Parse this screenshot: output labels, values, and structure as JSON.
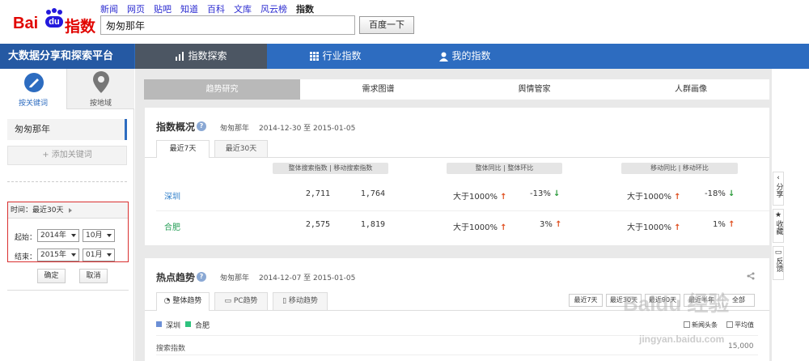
{
  "logo": {
    "bai": "Bai",
    "du": "du",
    "zhishu": "指数"
  },
  "topnav": [
    "新闻",
    "网页",
    "贴吧",
    "知道",
    "百科",
    "文库",
    "风云榜",
    "指数"
  ],
  "search": {
    "value": "匆匆那年",
    "button": "百度一下"
  },
  "nav": {
    "brand": "大数据分享和探索平台",
    "explore": "指数探索",
    "industry": "行业指数",
    "mine": "我的指数"
  },
  "sidebar": {
    "kw_tab": "按关键词",
    "area_tab": "按地域",
    "keyword": "匆匆那年",
    "add_kw": "+ 添加关键词",
    "time_header": "时间：最近30天",
    "start_label": "起始：",
    "end_label": "结束：",
    "start_year": "2014年",
    "start_month": "10月",
    "end_year": "2015年",
    "end_month": "01月",
    "confirm": "确定",
    "cancel": "取消"
  },
  "tabs": [
    "趋势研究",
    "需求图谱",
    "舆情管家",
    "人群画像"
  ],
  "overview": {
    "title": "指数概况",
    "keyword": "匆匆那年",
    "range": "2014-12-30 至 2015-01-05",
    "tab7": "最近7天",
    "tab30": "最近30天",
    "headers": {
      "search": "整体搜索指数",
      "mobile": "移动搜索指数",
      "yoy": "整体同比",
      "mom": "整体环比",
      "myoy": "移动同比",
      "mmom": "移动环比"
    },
    "rows": [
      {
        "city": "深圳",
        "search": "2,711",
        "mobile": "1,764",
        "yoy": "大于1000%",
        "mom": "-13%",
        "myoy": "大于1000%",
        "mmom": "-18%"
      },
      {
        "city": "合肥",
        "search": "2,575",
        "mobile": "1,819",
        "yoy": "大于1000%",
        "mom": "3%",
        "myoy": "大于1000%",
        "mmom": "1%"
      }
    ]
  },
  "trend": {
    "title": "热点趋势",
    "keyword": "匆匆那年",
    "range": "2014-12-07 至 2015-01-05",
    "subtabs": [
      "整体趋势",
      "PC趋势",
      "移动趋势"
    ],
    "ranges": [
      "最近7天",
      "最近30天",
      "最近90天",
      "最近半年",
      "全部"
    ],
    "legend": [
      "深圳",
      "合肥"
    ],
    "opt1": "新闻头条",
    "opt2": "平均值",
    "ylabel": "搜索指数",
    "ymax": "15,000"
  },
  "right_tools": [
    "分享",
    "收藏",
    "反馈"
  ],
  "watermark": {
    "main": "Baidu 经验",
    "url": "jingyan.baidu.com"
  },
  "colors": {
    "brand_blue": "#2d6cc0",
    "up": "#e05020",
    "down": "#2a9a3a",
    "legend_sz": "#6b8fd6",
    "legend_hf": "#2ec27e"
  }
}
